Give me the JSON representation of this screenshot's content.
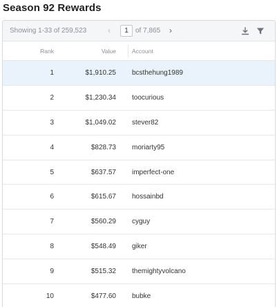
{
  "page": {
    "title": "Season 92 Rewards"
  },
  "toolbar": {
    "showing": "Showing 1-33 of 259,523",
    "prev_icon": "chevron-left-icon",
    "page_value": "1",
    "of_pages": "of 7,865",
    "next_icon": "chevron-right-icon",
    "download_icon": "download-icon",
    "filter_icon": "filter-icon"
  },
  "table": {
    "columns": [
      "Rank",
      "Value",
      "Account"
    ],
    "rows": [
      {
        "rank": "1",
        "value": "$1,910.25",
        "account": "bcsthehung1989"
      },
      {
        "rank": "2",
        "value": "$1,230.34",
        "account": "toocurious"
      },
      {
        "rank": "3",
        "value": "$1,049.02",
        "account": "stever82"
      },
      {
        "rank": "4",
        "value": "$828.73",
        "account": "moriarty95"
      },
      {
        "rank": "5",
        "value": "$637.57",
        "account": "imperfect-one"
      },
      {
        "rank": "6",
        "value": "$615.67",
        "account": "hossainbd"
      },
      {
        "rank": "7",
        "value": "$560.29",
        "account": "cyguy"
      },
      {
        "rank": "8",
        "value": "$548.49",
        "account": "giker"
      },
      {
        "rank": "9",
        "value": "$515.32",
        "account": "themightyvolcano"
      },
      {
        "rank": "10",
        "value": "$477.60",
        "account": "bubke"
      }
    ]
  },
  "colors": {
    "selected_row": "#eaf3fc",
    "toolbar_bg": "#f5f6f8",
    "border": "#d7dbe0"
  }
}
